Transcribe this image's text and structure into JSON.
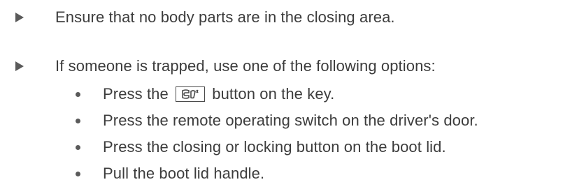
{
  "instructions": [
    {
      "icon": "arrow-right-icon",
      "text": "Ensure that no body parts are in the closing area."
    },
    {
      "icon": "arrow-right-icon",
      "text": "If someone is trapped, use one of the following options:"
    }
  ],
  "options": {
    "key_button": {
      "before": "Press the",
      "icon": "boot-lid-key-icon",
      "after": "button on the key."
    },
    "items": [
      "Press the remote operating switch on the driver's door.",
      "Press the closing or locking button on the boot lid.",
      "Pull the boot lid handle."
    ]
  },
  "colors": {
    "text": "#3c3c3c",
    "marker": "#5a5a5a"
  }
}
